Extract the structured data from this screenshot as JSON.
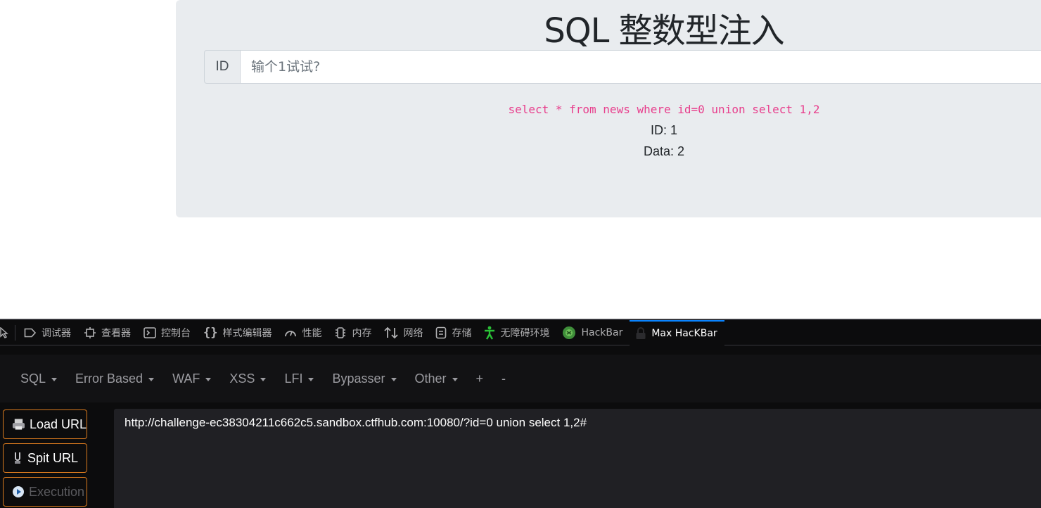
{
  "page": {
    "title": "SQL 整数型注入",
    "input_label": "ID",
    "input_placeholder": "输个1试试?",
    "query": "select * from news where id=0 union select 1,2",
    "result_id": "ID: 1",
    "result_data": "Data: 2"
  },
  "devtools": {
    "tabs": [
      {
        "label": "调试器",
        "icon": "debugger-icon"
      },
      {
        "label": "查看器",
        "icon": "inspector-icon"
      },
      {
        "label": "控制台",
        "icon": "console-icon"
      },
      {
        "label": "样式编辑器",
        "icon": "style-editor-icon"
      },
      {
        "label": "性能",
        "icon": "performance-icon"
      },
      {
        "label": "内存",
        "icon": "memory-icon"
      },
      {
        "label": "网络",
        "icon": "network-icon"
      },
      {
        "label": "存储",
        "icon": "storage-icon"
      },
      {
        "label": "无障碍环境",
        "icon": "accessibility-icon"
      },
      {
        "label": "HackBar",
        "icon": "hackbar-icon"
      },
      {
        "label": "Max HacKBar",
        "icon": "lock-icon",
        "active": true
      }
    ],
    "accent": "#0a84ff"
  },
  "hackbar": {
    "menu": [
      "SQL",
      "Error Based",
      "WAF",
      "XSS",
      "LFI",
      "Bypasser",
      "Other",
      "+",
      "-"
    ],
    "load_url": "Load URL",
    "split_url": "Spit URL",
    "execution": "Execution",
    "url": "http://challenge-ec38304211c662c5.sandbox.ctfhub.com:10080/?id=0 union select 1,2#",
    "button_border": "#d97a1e"
  }
}
